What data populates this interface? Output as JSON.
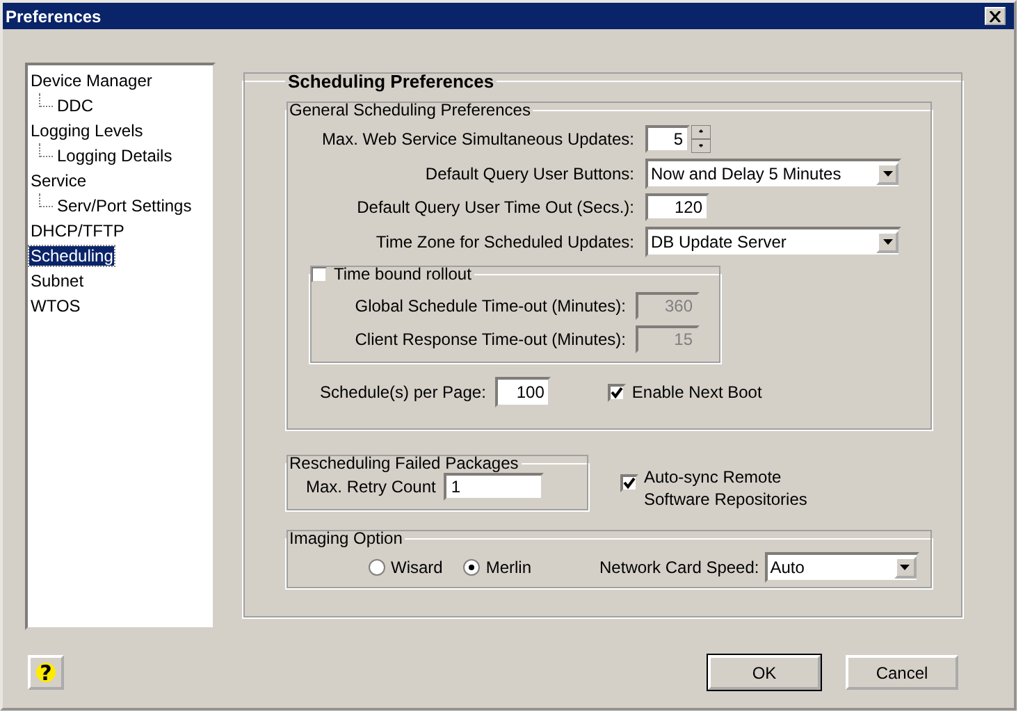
{
  "window": {
    "title": "Preferences"
  },
  "tree": [
    {
      "label": "Device Manager",
      "selected": false,
      "children": [
        {
          "label": "DDC",
          "selected": false
        }
      ]
    },
    {
      "label": "Logging Levels",
      "selected": false,
      "children": [
        {
          "label": "Logging Details",
          "selected": false
        }
      ]
    },
    {
      "label": "Service",
      "selected": false,
      "children": [
        {
          "label": "Serv/Port Settings",
          "selected": false
        }
      ]
    },
    {
      "label": "DHCP/TFTP",
      "selected": false
    },
    {
      "label": "Scheduling",
      "selected": true
    },
    {
      "label": "Subnet",
      "selected": false
    },
    {
      "label": "WTOS",
      "selected": false
    }
  ],
  "scheduling": {
    "title": "Scheduling Preferences",
    "general": {
      "title": "General Scheduling Preferences",
      "rows": [
        {
          "kind": "spinner",
          "label": "Max. Web Service Simultaneous Updates:",
          "value": "5"
        },
        {
          "kind": "dropdown",
          "label": "Default Query User Buttons:",
          "value": "Now and Delay 5 Minutes"
        },
        {
          "kind": "input",
          "label": "Default Query User Time Out (Secs.):",
          "value": "120"
        },
        {
          "kind": "dropdown",
          "label": "Time Zone for Scheduled Updates:",
          "value": "DB Update Server"
        }
      ],
      "time_bound": {
        "label": "Time bound rollout",
        "checked": false,
        "fields": [
          {
            "label": "Global Schedule Time-out (Minutes):",
            "value": "360",
            "disabled": true
          },
          {
            "label": "Client Response Time-out  (Minutes):",
            "value": "15",
            "disabled": true
          }
        ]
      },
      "per_page": {
        "label": "Schedule(s) per Page:",
        "value": "100"
      },
      "next_boot": {
        "label": "Enable Next Boot",
        "checked": true
      }
    },
    "rescheduling": {
      "title": "Rescheduling Failed Packages",
      "label": "Max. Retry Count",
      "value": "1"
    },
    "auto_sync": {
      "label": "Auto-sync Remote Software Repositories",
      "checked": true
    },
    "imaging": {
      "title": "Imaging Option",
      "options": [
        {
          "label": "Wisard",
          "selected": false
        },
        {
          "label": "Merlin",
          "selected": true
        }
      ],
      "speed": {
        "label": "Network Card Speed:",
        "value": "Auto"
      }
    }
  },
  "help": "?",
  "buttons": [
    "OK",
    "Cancel"
  ]
}
